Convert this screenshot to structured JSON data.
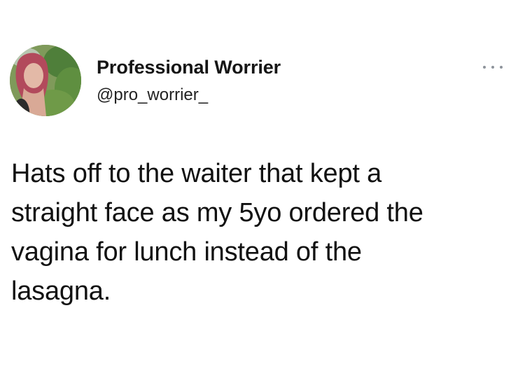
{
  "tweet": {
    "author": {
      "display_name": "Professional Worrier",
      "handle": "@pro_worrier_",
      "avatar_icon": "user-avatar-photo"
    },
    "more_icon": "ellipsis-icon",
    "text_lines": [
      "Hats off to the waiter that kept a",
      "straight face as my 5yo ordered the",
      "vagina for lunch instead of the",
      "lasagna."
    ]
  },
  "colors": {
    "background": "#ffffff",
    "text": "#111111",
    "muted": "#8e949b"
  }
}
